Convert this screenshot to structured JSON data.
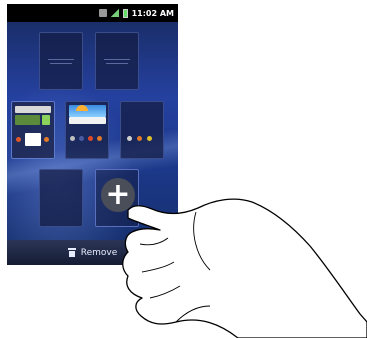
{
  "status_bar": {
    "time": "11:02 AM"
  },
  "remove_bar": {
    "label": "Remove"
  },
  "add_panel": {
    "symbol": "+"
  }
}
